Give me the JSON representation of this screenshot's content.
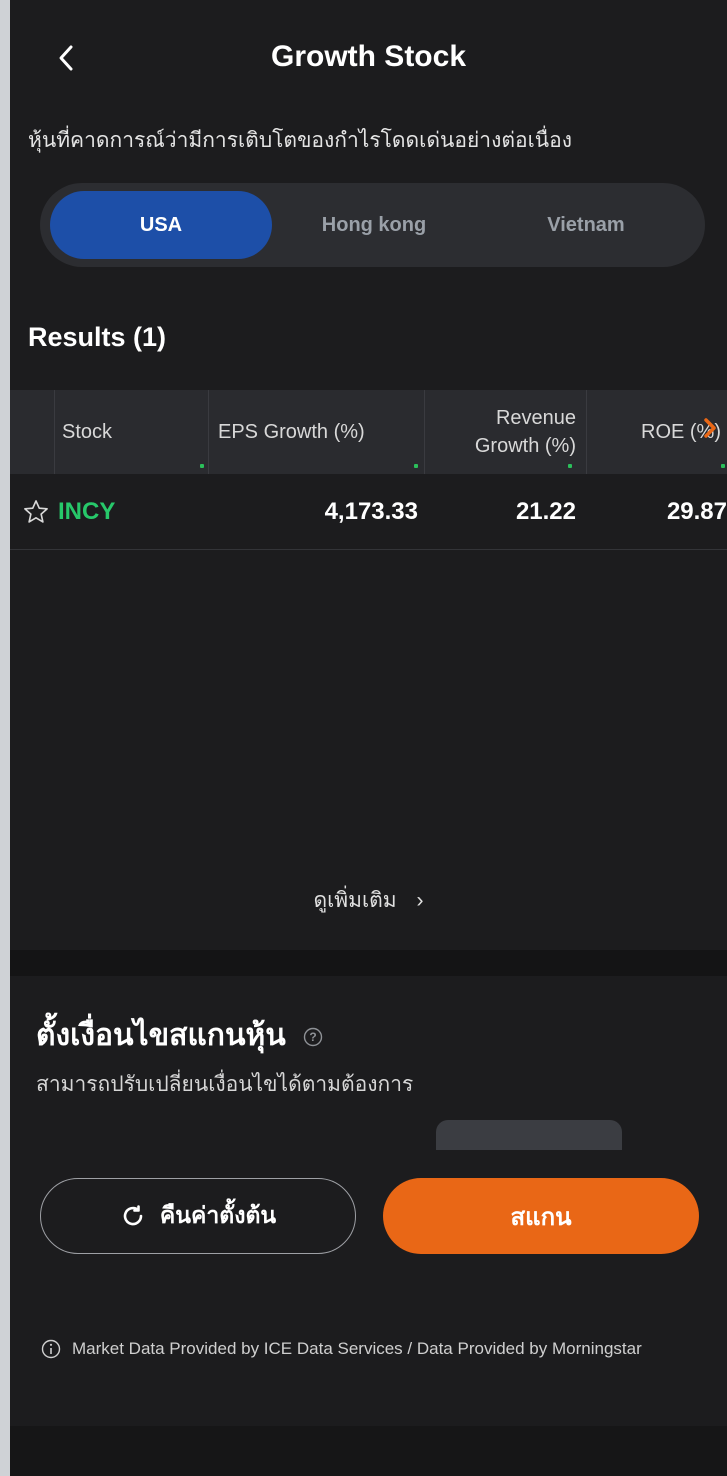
{
  "header": {
    "title": "Growth Stock",
    "back_icon": "chevron-left-icon"
  },
  "subtitle": "หุ้นที่คาดการณ์ว่ามีการเติบโตของกำไรโดดเด่นอย่างต่อเนื่อง",
  "markets": {
    "tabs": [
      {
        "label": "USA",
        "active": true
      },
      {
        "label": "Hong kong",
        "active": false
      },
      {
        "label": "Vietnam",
        "active": false
      }
    ]
  },
  "results": {
    "title": "Results (1)",
    "columns": [
      "Stock",
      "EPS Growth (%)",
      "Revenue",
      "Growth (%)",
      "ROE (%)"
    ],
    "rows": [
      {
        "ticker": "INCY",
        "eps_growth": "4,173.33",
        "revenue_growth": "21.22",
        "roe": "29.87"
      }
    ],
    "more_label": "ดูเพิ่มเติม"
  },
  "scanner": {
    "title": "ตั้งเงื่อนไขสแกนหุ้น",
    "subtitle": "สามารถปรับเปลี่ยนเงื่อนไขได้ตามต้องการ",
    "reset_label": "คืนค่าตั้งต้น",
    "scan_label": "สแกน"
  },
  "footnote": "Market Data Provided by ICE Data Services / Data Provided by Morningstar",
  "colors": {
    "background": "#1c1c1e",
    "active_tab": "#1d4fa8",
    "ticker_green": "#27c86a",
    "scan_orange": "#e96716",
    "scroll_arrow": "#e96716"
  }
}
